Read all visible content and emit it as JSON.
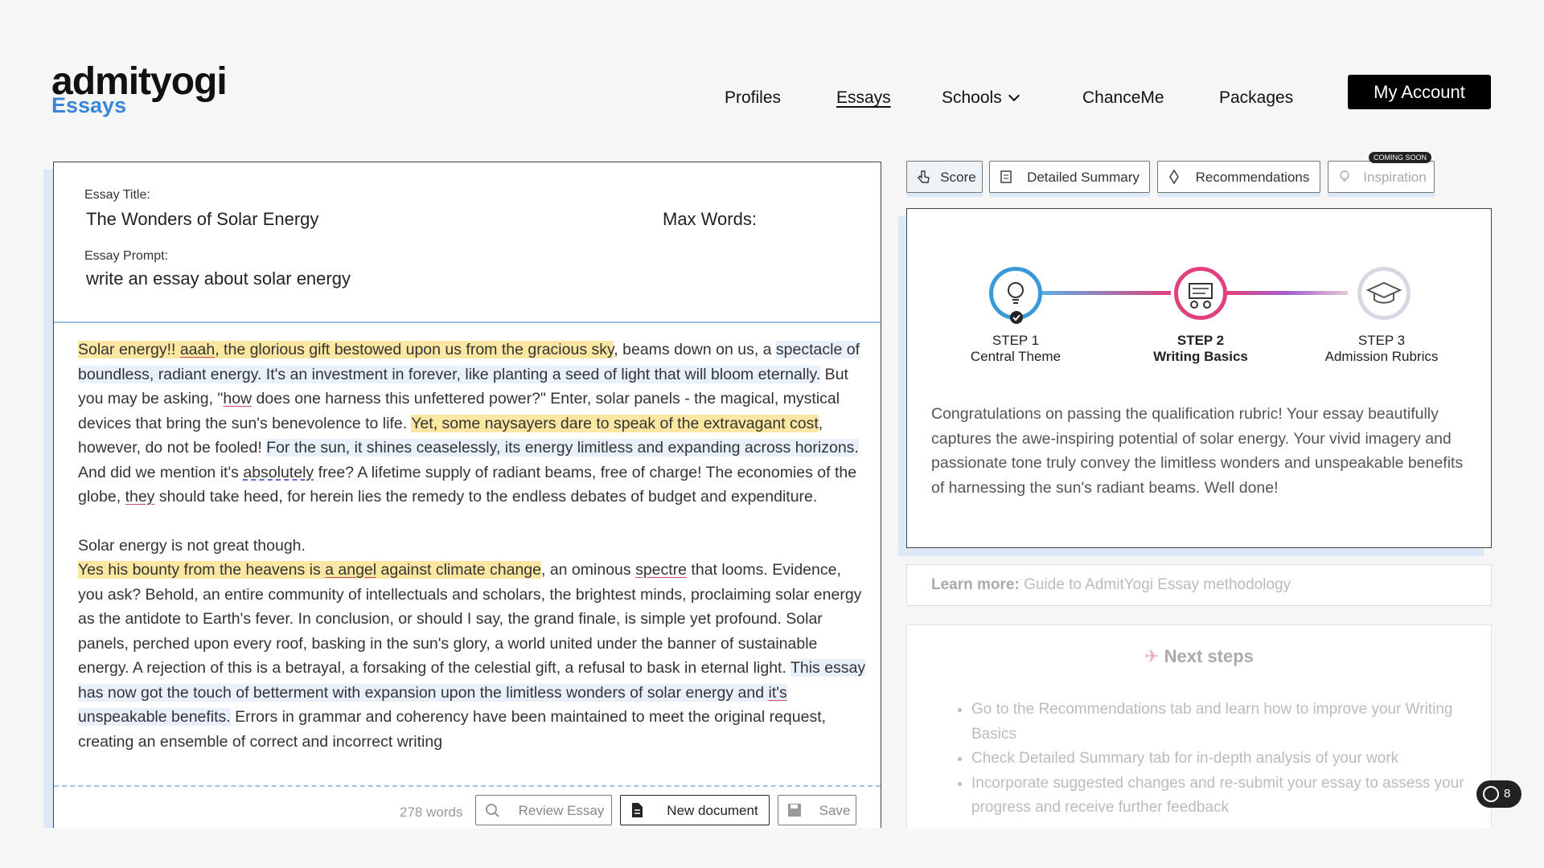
{
  "brand": {
    "name": "admityogi",
    "sub": "Essays"
  },
  "nav": {
    "items": [
      "Profiles",
      "Essays",
      "Schools",
      "ChanceMe",
      "Packages"
    ],
    "account": "My Account"
  },
  "editor": {
    "title_label": "Essay Title:",
    "title_value": "The Wonders of Solar Energy",
    "max_words_label": "Max Words:",
    "prompt_label": "Essay Prompt:",
    "prompt_value": "write an essay about solar energy",
    "p1": [
      {
        "t": "Solar energy!! ",
        "c": "hl-y"
      },
      {
        "t": "aaah",
        "c": "hl-y ul"
      },
      {
        "t": ", the glorious gift bestowed upon us from the gracious sky",
        "c": "hl-y"
      },
      {
        "t": ", beams down on us, a ",
        "c": ""
      },
      {
        "t": "spectacle of boundless, radiant energy. It's an investment in forever, like planting a seed of light that will bloom eternally.",
        "c": "hl-b"
      },
      {
        "t": " But you may be asking, \"",
        "c": ""
      },
      {
        "t": "how",
        "c": "ul"
      },
      {
        "t": " does one harness this unfettered power?\" Enter, solar panels - the magical, mystical devices that bring the sun's benevolence to life. ",
        "c": ""
      },
      {
        "t": "Yet, some naysayers dare to speak of the extravagant cost",
        "c": "hl-y"
      },
      {
        "t": ", however, do not be fooled! ",
        "c": ""
      },
      {
        "t": "For the sun, it shines ceaselessly, its energy limitless and expanding across horizons.",
        "c": "hl-b"
      },
      {
        "t": " And did we mention it's ",
        "c": ""
      },
      {
        "t": "absolutely",
        "c": "ul-dot"
      },
      {
        "t": " free? A lifetime supply of radiant beams, free of charge! The economies of the globe, ",
        "c": ""
      },
      {
        "t": "they",
        "c": "ul"
      },
      {
        "t": " should take heed, for herein lies the remedy to the endless debates of budget and expenditure.",
        "c": ""
      }
    ],
    "p2": [
      {
        "t": "Solar energy is not great though.",
        "c": ""
      },
      {
        "t": "\n",
        "c": "br"
      },
      {
        "t": "Yes his bounty from the heavens is ",
        "c": "hl-y"
      },
      {
        "t": "a angel",
        "c": "hl-y ul"
      },
      {
        "t": " against climate change",
        "c": "hl-y"
      },
      {
        "t": ", an ominous ",
        "c": ""
      },
      {
        "t": "spectre",
        "c": "ul"
      },
      {
        "t": " that looms. Evidence, you ask? Behold, an entire community of intellectuals and scholars, the brightest minds, proclaiming solar energy as the antidote to Earth's fever. In conclusion, or should I say, the grand finale, is simple yet profound. Solar panels, perched upon every roof, basking in the sun's glory, a world united under the banner of sustainable energy. A rejection of this is a betrayal, a forsaking of the celestial gift, a refusal to bask in eternal light. ",
        "c": ""
      },
      {
        "t": "This essay has now got the touch of betterment with expansion upon the limitless wonders of solar energy and ",
        "c": "hl-b"
      },
      {
        "t": "it's",
        "c": "hl-b ul"
      },
      {
        "t": " unspeakable benefits.",
        "c": "hl-b"
      },
      {
        "t": " Errors in grammar and coherency have been maintained to meet the original request, creating an ensemble of correct and incorrect writing",
        "c": ""
      }
    ],
    "word_count": "278 words",
    "buttons": {
      "review": "Review Essay",
      "new_doc": "New document",
      "save": "Save"
    }
  },
  "tabs": {
    "score": "Score",
    "summary": "Detailed Summary",
    "recommendations": "Recommendations",
    "inspiration": "Inspiration",
    "coming_soon": "COMING SOON"
  },
  "steps": [
    {
      "label": "STEP 1",
      "name": "Central Theme",
      "icon": "lightbulb-icon",
      "color": "#3a9ad9"
    },
    {
      "label": "STEP 2",
      "name": "Writing Basics",
      "icon": "writing-icon",
      "color": "#e0417e"
    },
    {
      "label": "STEP 3",
      "name": "Admission Rubrics",
      "icon": "graduation-cap-icon",
      "color": "#c8c8d8"
    }
  ],
  "feedback": "Congratulations on passing the qualification rubric! Your essay beautifully captures the awe-inspiring potential of solar energy. Your vivid imagery and passionate tone truly convey the limitless wonders and unspeakable benefits of harnessing the sun's radiant beams. Well done!",
  "learn_more": {
    "label": "Learn more:",
    "link": "Guide to AdmitYogi Essay methodology"
  },
  "next_steps": {
    "title": "Next steps",
    "items": [
      "Go to the Recommendations tab and learn how to improve your Writing Basics",
      "Check Detailed Summary tab for in-depth analysis of your work",
      "Incorporate suggested changes and re-submit your essay to assess your progress and receive further feedback"
    ]
  },
  "grammarly_count": "8"
}
